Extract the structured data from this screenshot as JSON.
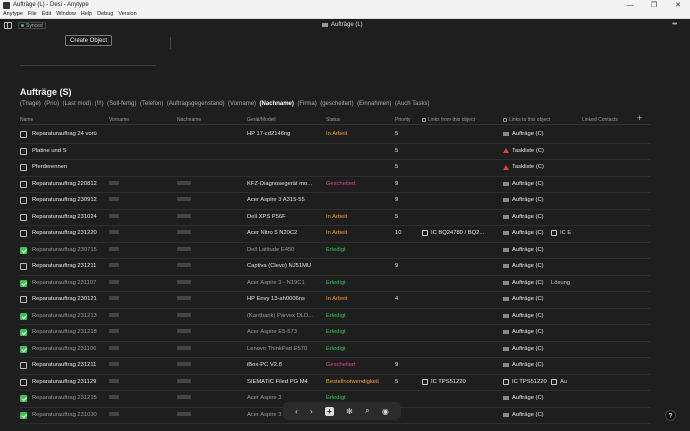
{
  "window": {
    "title": "Aufträge (L) - Desi - Anytype",
    "controls": [
      "—",
      "❐",
      "✕"
    ]
  },
  "menubar": [
    "Anytype",
    "File",
    "Edit",
    "Window",
    "Help",
    "Debug",
    "Version"
  ],
  "appbar": {
    "sync_status": "Synced",
    "document_title": "Aufträge (L)",
    "more": "•••"
  },
  "create_object_label": "Create Object",
  "set": {
    "title": "Aufträge (S)",
    "views": [
      "(Triage)",
      "(Prio)",
      "(Last mod)",
      "(!!!)",
      "(Soll-fertig)",
      "(Telefon)",
      "(Auftragsgegenstand)",
      "(Vorname)",
      "(Nachname)",
      "(Firma)",
      "(gescheitert)",
      "(Einnahmen)",
      "(Auch Tasks)"
    ],
    "active_view": "(Nachname)"
  },
  "columns": {
    "name": "Name",
    "vorname": "Vorname",
    "nachname": "Nachname",
    "device": "Gerät/Modell",
    "status": "Status",
    "priority": "Priority",
    "links_from": "Links from this object",
    "links_to": "Links to this object",
    "linked_contacts": "Linked Contacts",
    "add": "+"
  },
  "status_colors": {
    "In Arbeit": "#e8a13a",
    "Erledigt": "#3fbf5a",
    "Gescheitert": "#d9488f",
    "Bestellnotwendigkeit": "#e8a13a"
  },
  "rows": [
    {
      "done": false,
      "name": "Reparaturauftrag 24 vorü",
      "vor": false,
      "nach": false,
      "device": "HP 17-cd2146ng",
      "status": "In Arbeit",
      "prio": "5",
      "links": "",
      "to": "Aufträge (C)",
      "to_icon": "doc",
      "extra": ""
    },
    {
      "done": false,
      "name": "Platine und S",
      "vor": false,
      "nach": false,
      "device": "",
      "status": "",
      "prio": "5",
      "links": "",
      "to": "Taskliste (C)",
      "to_icon": "warn",
      "extra": ""
    },
    {
      "done": false,
      "name": "Pferderennen",
      "vor": false,
      "nach": false,
      "device": "",
      "status": "",
      "prio": "5",
      "links": "",
      "to": "Taskliste (C)",
      "to_icon": "warn",
      "extra": ""
    },
    {
      "done": false,
      "name": "Reparaturauftrag 220812",
      "vor": true,
      "nach": true,
      "device": "KFZ-Diagnosegerät mo...",
      "status": "Gescheitert",
      "prio": "9",
      "links": "",
      "to": "Aufträge (C)",
      "to_icon": "doc",
      "extra": ""
    },
    {
      "done": false,
      "name": "Reparaturauftrag 230912",
      "vor": true,
      "nach": true,
      "device": "Acer Aspire 3 A315-55",
      "status": "",
      "prio": "9",
      "links": "",
      "to": "Aufträge (C)",
      "to_icon": "doc",
      "extra": ""
    },
    {
      "done": false,
      "name": "Reparaturauftrag 231024",
      "vor": true,
      "nach": true,
      "device": "Dell XPS P56F",
      "status": "In Arbeit",
      "prio": "5",
      "links": "",
      "to": "Aufträge (C)",
      "to_icon": "doc",
      "extra": ""
    },
    {
      "done": false,
      "name": "Reparaturauftrag 231220",
      "vor": true,
      "nach": true,
      "device": "Acer Nitro 5 N20C2",
      "status": "In Arbeit",
      "prio": "10",
      "links": "IC BQ24780 / BQ2...",
      "to": "Aufträge (C)",
      "to_icon": "doc",
      "extra": "IC E"
    },
    {
      "done": true,
      "name": "Reparaturauftrag 230715",
      "vor": true,
      "nach": true,
      "device": "Dell Latitude E450",
      "status": "Erledigt",
      "prio": "",
      "links": "",
      "to": "Aufträge (C)",
      "to_icon": "doc",
      "extra": ""
    },
    {
      "done": false,
      "name": "Reparaturauftrag 231211",
      "vor": true,
      "nach": true,
      "device": "Captiva (Clevo) NJ51MU",
      "status": "",
      "prio": "9",
      "links": "",
      "to": "Aufträge (C)",
      "to_icon": "doc",
      "extra": ""
    },
    {
      "done": true,
      "name": "Reparaturauftrag 231107",
      "vor": true,
      "nach": true,
      "device": "Acer Aspire 3 - N19C1",
      "status": "Erledigt",
      "prio": "",
      "links": "",
      "to": "Aufträge (C)",
      "to_icon": "doc",
      "extra": "Lösung"
    },
    {
      "done": false,
      "name": "Reparaturauftrag 230121",
      "vor": true,
      "nach": true,
      "device": "HP Envy 13-ah0006ns",
      "status": "In Arbeit",
      "prio": "4",
      "links": "",
      "to": "Aufträge (C)",
      "to_icon": "doc",
      "extra": ""
    },
    {
      "done": true,
      "name": "Reparaturauftrag 231213",
      "vor": true,
      "nach": true,
      "device": "(Kantbank) Parvex DLD...",
      "status": "Erledigt",
      "prio": "",
      "links": "",
      "to": "Aufträge (C)",
      "to_icon": "doc",
      "extra": ""
    },
    {
      "done": true,
      "name": "Reparaturauftrag 231218",
      "vor": true,
      "nach": true,
      "device": "Acer Aspire E5-573",
      "status": "Erledigt",
      "prio": "",
      "links": "",
      "to": "Aufträge (C)",
      "to_icon": "doc",
      "extra": ""
    },
    {
      "done": true,
      "name": "Reparaturauftrag 231106",
      "vor": true,
      "nach": true,
      "device": "Lenovo ThinkPad E570",
      "status": "Erledigt",
      "prio": "",
      "links": "",
      "to": "Aufträge (C)",
      "to_icon": "doc",
      "extra": ""
    },
    {
      "done": false,
      "name": "Reparaturauftrag 231211",
      "vor": true,
      "nach": true,
      "device": "iBox-PC V2.8",
      "status": "Gescheitert",
      "prio": "9",
      "links": "",
      "to": "Aufträge (C)",
      "to_icon": "doc",
      "extra": ""
    },
    {
      "done": false,
      "name": "Reparaturauftrag 231129",
      "vor": true,
      "nach": true,
      "device": "SIEMATIC Filed PG M4",
      "status": "Bestellnotwendigkeit",
      "prio": "5",
      "links": "IC TPS51220",
      "to": "IC TPS51220",
      "to_icon": "box",
      "extra": "Au"
    },
    {
      "done": true,
      "name": "Reparaturauftrag 231215",
      "vor": true,
      "nach": true,
      "device": "Acer Aspire 3",
      "status": "Erledigt",
      "prio": "",
      "links": "",
      "to": "Aufträge (C)",
      "to_icon": "doc",
      "extra": ""
    },
    {
      "done": true,
      "name": "Reparaturauftrag 231030",
      "vor": true,
      "nach": true,
      "device": "Acer Aspire 3",
      "status": "Erledigt",
      "prio": "",
      "links": "",
      "to": "Aufträge (C)",
      "to_icon": "doc",
      "extra": ""
    }
  ],
  "floatbar": {
    "back": "‹",
    "forward": "›",
    "add": "+",
    "graph": "✻",
    "search": "⌕",
    "widget": "◉"
  },
  "help": "?"
}
